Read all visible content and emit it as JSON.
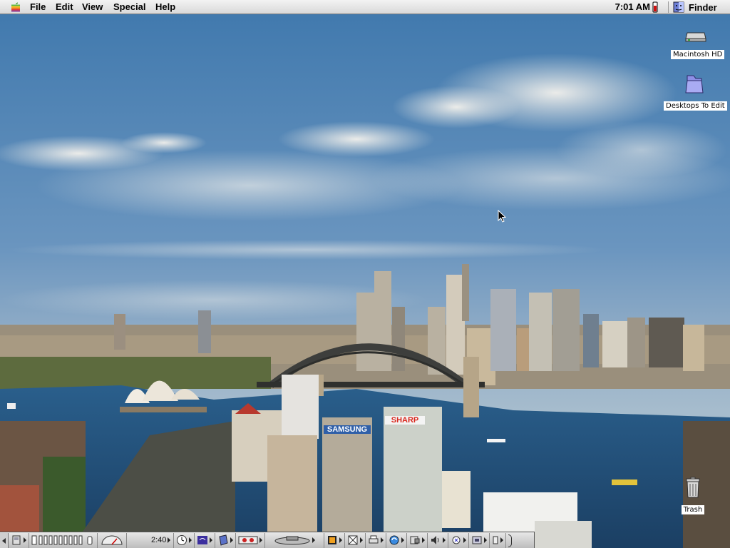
{
  "menubar": {
    "apple_icon": "apple-logo-icon",
    "menus": [
      "File",
      "Edit",
      "View",
      "Special",
      "Help"
    ],
    "clock": "7:01 AM",
    "battery_icon": "battery-icon",
    "active_app": "Finder",
    "active_app_icon": "finder-icon"
  },
  "desktop": {
    "icons": [
      {
        "label": "Macintosh HD",
        "icon": "hard-disk-icon"
      },
      {
        "label": "Desktops To Edit",
        "icon": "folder-icon"
      },
      {
        "label": "Trash",
        "icon": "trash-icon"
      }
    ],
    "wallpaper_signs": [
      "SAMSUNG",
      "SHARP"
    ]
  },
  "control_strip": {
    "battery_time": "2:40",
    "modules": [
      "applescript-icon",
      "battery-level-icon",
      "speed-icon",
      "time-icon",
      "remote-access-icon",
      "printer-icon",
      "sharing-icon",
      "cd-icon",
      "monitor-icon",
      "file-sharing-icon",
      "desktop-printer-icon",
      "internet-icon",
      "keychain-icon",
      "sound-volume-icon",
      "speech-icon",
      "location-icon",
      "web-sharing-icon"
    ]
  },
  "colors": {
    "menubar": "#dcdcdc",
    "sky": "#4f86b8",
    "water": "#1f4f78",
    "label_bg": "#ffffff"
  }
}
